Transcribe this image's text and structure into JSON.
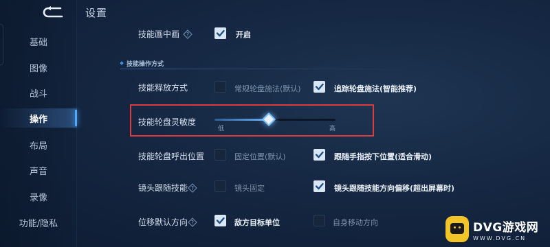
{
  "header": {
    "title": "设置"
  },
  "sidebar": {
    "items": [
      {
        "label": "基础"
      },
      {
        "label": "图像"
      },
      {
        "label": "战斗"
      },
      {
        "label": "操作",
        "active": true
      },
      {
        "label": "布局"
      },
      {
        "label": "声音"
      },
      {
        "label": "录像"
      },
      {
        "label": "功能/隐私"
      },
      {
        "label": ""
      }
    ]
  },
  "settings": {
    "skill_pip": {
      "label": "技能画中画",
      "option_label": "开启",
      "checked": true
    },
    "section": {
      "title": "技能操作方式"
    },
    "cast_mode": {
      "label": "技能释放方式",
      "option1": {
        "label": "常规轮盘施法(默认)",
        "checked": false
      },
      "option2": {
        "label": "追踪轮盘施法(智能推荐)",
        "checked": true
      }
    },
    "wheel_sensitivity": {
      "label": "技能轮盘灵敏度",
      "min_label": "低",
      "max_label": "高",
      "value": 0.45
    },
    "wheel_position": {
      "label": "技能轮盘呼出位置",
      "option1": {
        "label": "固定位置(默认)",
        "checked": false
      },
      "option2": {
        "label": "跟随手指按下位置(适合滑动)",
        "checked": true
      }
    },
    "camera_follow": {
      "label": "镜头跟随技能",
      "option1": {
        "label": "镜头固定",
        "checked": false
      },
      "option2": {
        "label": "镜头跟随技能方向偏移(超出屏幕时)",
        "checked": true
      }
    },
    "move_direction": {
      "label": "位移默认方向",
      "option1": {
        "label": "敌方目标单位",
        "checked": true
      },
      "option2": {
        "label": "自身移动方向",
        "checked": false
      }
    }
  },
  "watermark": {
    "brand": "DVG游戏网",
    "url": "WWW.DVG.CN"
  },
  "colors": {
    "accent": "#4fa8ff",
    "highlight_border": "#e03a3a",
    "logo_yellow": "#f3c428"
  }
}
